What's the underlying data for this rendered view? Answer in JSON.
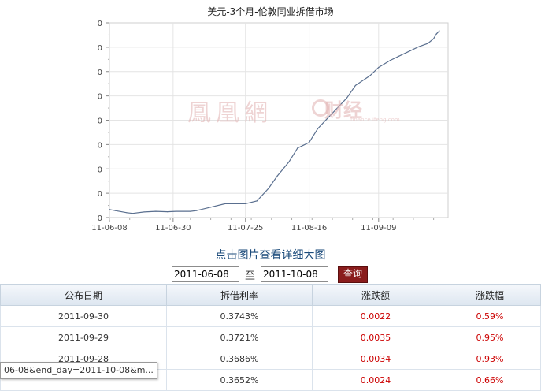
{
  "chart_data": {
    "type": "line",
    "title": "美元-3个月-伦敦同业拆借市场",
    "x_tick_labels": [
      "11-06-08",
      "11-06-30",
      "11-07-25",
      "11-08-16",
      "11-09-09"
    ],
    "y_tick_labels": [
      "0",
      "0",
      "0",
      "0",
      "0",
      "0",
      "0",
      "0",
      "0"
    ],
    "grid": true,
    "series": [
      {
        "values": [
          {
            "x": "2011-06-08",
            "y": 0.2458
          },
          {
            "x": "2011-06-10",
            "y": 0.245
          },
          {
            "x": "2011-06-14",
            "y": 0.2435
          },
          {
            "x": "2011-06-16",
            "y": 0.243
          },
          {
            "x": "2011-06-20",
            "y": 0.244
          },
          {
            "x": "2011-06-24",
            "y": 0.2445
          },
          {
            "x": "2011-06-28",
            "y": 0.2442
          },
          {
            "x": "2011-07-01",
            "y": 0.2445
          },
          {
            "x": "2011-07-06",
            "y": 0.2445
          },
          {
            "x": "2011-07-08",
            "y": 0.245
          },
          {
            "x": "2011-07-13",
            "y": 0.2475
          },
          {
            "x": "2011-07-18",
            "y": 0.25
          },
          {
            "x": "2011-07-25",
            "y": 0.25
          },
          {
            "x": "2011-07-29",
            "y": 0.252
          },
          {
            "x": "2011-08-02",
            "y": 0.261
          },
          {
            "x": "2011-08-05",
            "y": 0.27
          },
          {
            "x": "2011-08-09",
            "y": 0.28
          },
          {
            "x": "2011-08-12",
            "y": 0.29
          },
          {
            "x": "2011-08-16",
            "y": 0.294
          },
          {
            "x": "2011-08-19",
            "y": 0.304
          },
          {
            "x": "2011-08-24",
            "y": 0.315
          },
          {
            "x": "2011-08-29",
            "y": 0.326
          },
          {
            "x": "2011-09-01",
            "y": 0.335
          },
          {
            "x": "2011-09-06",
            "y": 0.342
          },
          {
            "x": "2011-09-09",
            "y": 0.348
          },
          {
            "x": "2011-09-13",
            "y": 0.353
          },
          {
            "x": "2011-09-16",
            "y": 0.356
          },
          {
            "x": "2011-09-20",
            "y": 0.36
          },
          {
            "x": "2011-09-23",
            "y": 0.363
          },
          {
            "x": "2011-09-26",
            "y": 0.3652
          },
          {
            "x": "2011-09-28",
            "y": 0.3686
          },
          {
            "x": "2011-09-29",
            "y": 0.3721
          },
          {
            "x": "2011-09-30",
            "y": 0.3743
          }
        ]
      }
    ],
    "x_range": [
      "2011-06-08",
      "2011-10-03"
    ],
    "ylim": [
      0.24,
      0.38
    ],
    "line_color": "#5a6f8f"
  },
  "watermark": {
    "chinese": "鳳凰網",
    "finance": "财经",
    "url": "finance.ifeng.com"
  },
  "view_larger_label": "点击图片查看详细大图",
  "date_filter": {
    "start": "2011-06-08",
    "to_label": "至",
    "end": "2011-10-08",
    "query_label": "查询"
  },
  "table": {
    "headers": [
      "公布日期",
      "拆借利率",
      "涨跌额",
      "涨跌幅"
    ],
    "rows": [
      [
        "2011-09-30",
        "0.3743%",
        "0.0022",
        "0.59%"
      ],
      [
        "2011-09-29",
        "0.3721%",
        "0.0035",
        "0.95%"
      ],
      [
        "2011-09-28",
        "0.3686%",
        "0.0034",
        "0.93%"
      ],
      [
        "",
        "0.3652%",
        "0.0024",
        "0.66%"
      ]
    ]
  },
  "status_tip": "06-08&end_day=2011-10-08&m..."
}
